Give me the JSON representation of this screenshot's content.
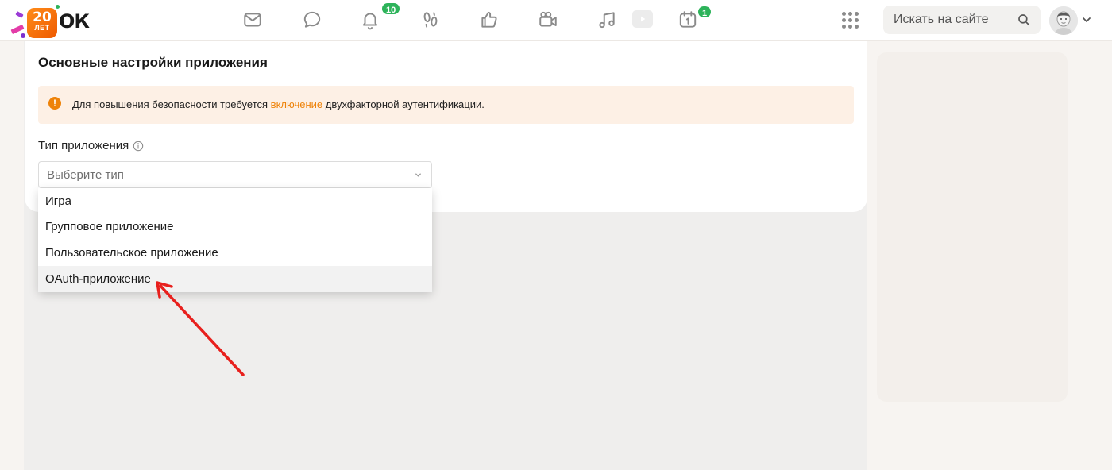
{
  "header": {
    "logo": {
      "badge_number": "20",
      "badge_word": "ЛЕТ",
      "brand": "ОК"
    },
    "nav_icons": [
      "mail-icon",
      "chat-icon",
      "bell-icon",
      "footprints-icon",
      "like-icon",
      "video-camera-icon",
      "music-icon",
      "play-icon",
      "calendar-icon"
    ],
    "notifications_badge": "10",
    "calendar_badge": "1",
    "search": {
      "placeholder": "Искать на сайте"
    }
  },
  "card": {
    "title": "Основные настройки приложения",
    "alert": {
      "text_before": "Для повышения безопасности требуется ",
      "link_text": "включение",
      "text_after": " двухфакторной аутентификации."
    },
    "app_type": {
      "label": "Тип приложения",
      "placeholder": "Выберите тип",
      "options": [
        "Игра",
        "Групповое приложение",
        "Пользовательское приложение",
        "OAuth-приложение"
      ],
      "highlighted_option": "OAuth-приложение"
    }
  },
  "colors": {
    "accent_orange": "#ee8208",
    "badge_green": "#2db35a",
    "alert_bg": "#fdf0e5",
    "annotation_arrow": "#e8201d"
  }
}
